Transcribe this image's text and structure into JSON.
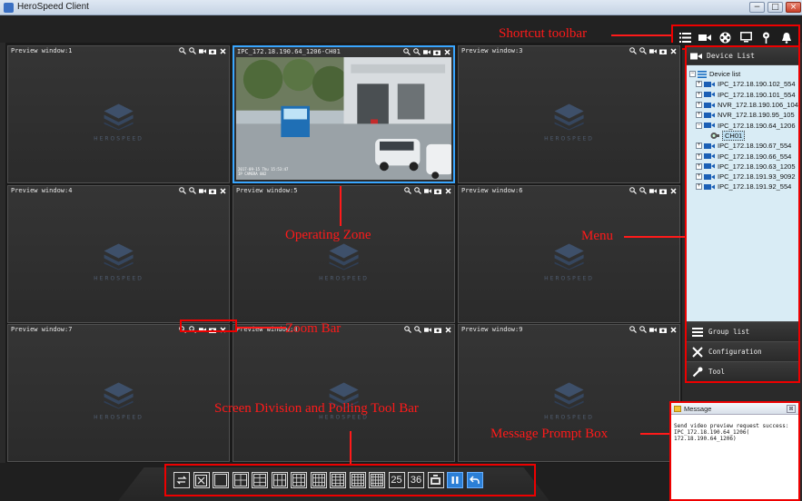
{
  "window": {
    "title": "HeroSpeed Client",
    "controls": [
      "−",
      "□",
      "×"
    ]
  },
  "shortcut_toolbar": {
    "icons": [
      "list-icon",
      "camera-icon",
      "film-reel-icon",
      "monitor-icon",
      "map-pin-icon",
      "alarm-bell-icon"
    ]
  },
  "preview": {
    "logo_text": "HEROSPEED",
    "panes": [
      {
        "title": "Preview window:1"
      },
      {
        "title": "IPC_172.18.190.64_1206-CH01",
        "live": true
      },
      {
        "title": "Preview window:3"
      },
      {
        "title": "Preview window:4"
      },
      {
        "title": "Preview window:5"
      },
      {
        "title": "Preview window:6"
      },
      {
        "title": "Preview window:7"
      },
      {
        "title": "Preview window:8"
      },
      {
        "title": "Preview window:9"
      }
    ],
    "cam_timestamp": "2017-09-15 Thu 15:53:47",
    "cam_sub": "IP CAMERA 002"
  },
  "sidebar": {
    "device_list_label": "Device List",
    "tree_root": "Device list",
    "devices": [
      {
        "label": "IPC_172.18.190.102_554",
        "exp": "+"
      },
      {
        "label": "IPC_172.18.190.101_554",
        "exp": "+"
      },
      {
        "label": "NVR_172.18.190.106_104",
        "exp": "+"
      },
      {
        "label": "NVR_172.18.190.95_105",
        "exp": "+"
      },
      {
        "label": "IPC_172.18.190.64_1206",
        "exp": "−"
      },
      {
        "label": "CH01",
        "child": true
      },
      {
        "label": "IPC_172.18.190.67_554",
        "exp": "+"
      },
      {
        "label": "IPC_172.18.190.66_554",
        "exp": "+"
      },
      {
        "label": "IPC_172.18.190.63_1205",
        "exp": "+"
      },
      {
        "label": "IPC_172.18.191.93_9092",
        "exp": "+"
      },
      {
        "label": "IPC_172.18.191.92_554",
        "exp": "+"
      }
    ],
    "group_list_label": "Group list",
    "configuration_label": "Configuration",
    "tool_label": "Tool"
  },
  "message": {
    "title": "Message",
    "close": "⊠",
    "body": "Send video preview request success:\nIPC_172.18.190.64_1206(\n172.18.190.64_1206)"
  },
  "division_bar": {
    "buttons": [
      "⇄",
      "⤢",
      "1",
      "4",
      "6",
      "8",
      "9",
      "10",
      "13",
      "16",
      "20",
      "25",
      "36",
      "▣",
      "⏸",
      "↶"
    ],
    "label_25": "25",
    "label_36": "36"
  },
  "annotations": {
    "shortcut_toolbar": "Shortcut toolbar",
    "operating_zone": "Operating Zone",
    "menu": "Menu",
    "zoom_bar": "Zoom Bar",
    "screen_division": "Screen Division and Polling Tool Bar",
    "message_prompt": "Message Prompt Box"
  },
  "colors": {
    "annotation": "#ff1a1a",
    "selected_pane": "#39a6ff",
    "tree_bg": "#d9ecf5"
  }
}
